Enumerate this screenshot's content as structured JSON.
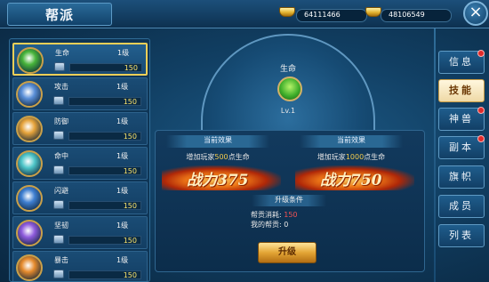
{
  "header": {
    "title": "帮派",
    "close_symbol": "×"
  },
  "currency": {
    "gold": "64111466",
    "silver": "48106549"
  },
  "skills": [
    {
      "name": "生命",
      "level": "1级",
      "cost": "150",
      "icon": "hp-potion-icon",
      "color": "#47b43a",
      "selected": true
    },
    {
      "name": "攻击",
      "level": "1级",
      "cost": "150",
      "icon": "sword-slash-icon",
      "color": "#5a8fd8"
    },
    {
      "name": "防御",
      "level": "1级",
      "cost": "150",
      "icon": "shield-icon",
      "color": "#e6a33a"
    },
    {
      "name": "命中",
      "level": "1级",
      "cost": "150",
      "icon": "eye-icon",
      "color": "#4fc6c9"
    },
    {
      "name": "闪避",
      "level": "1级",
      "cost": "150",
      "icon": "dodge-figure-icon",
      "color": "#3f7fd1"
    },
    {
      "name": "坚韧",
      "level": "1级",
      "cost": "150",
      "icon": "tough-body-icon",
      "color": "#8e5bdc"
    },
    {
      "name": "暴击",
      "level": "1级",
      "cost": "150",
      "icon": "crit-burst-icon",
      "color": "#e58a2c"
    }
  ],
  "detail": {
    "title": "生命",
    "level": "Lv.1",
    "current": {
      "header": "当前效果",
      "prefix": "增加玩家",
      "amount": "500",
      "suffix": "点生命",
      "power_label": "战力",
      "power": "375"
    },
    "next": {
      "header": "当前效果",
      "prefix": "增加玩家",
      "amount": "1000",
      "suffix": "点生命",
      "power_label": "战力",
      "power": "750"
    },
    "upgrade": {
      "header": "升级条件",
      "cost_label": "帮贡消耗:",
      "cost_value": "150",
      "have_label": "我的帮贡:",
      "have_value": "0",
      "button": "升级"
    }
  },
  "tabs": [
    {
      "label": "信息",
      "badge": true
    },
    {
      "label": "技能",
      "active": true
    },
    {
      "label": "神兽",
      "badge": true
    },
    {
      "label": "副本",
      "badge": true
    },
    {
      "label": "旗帜"
    },
    {
      "label": "成员"
    },
    {
      "label": "列表"
    }
  ],
  "colors": {
    "accent_gold": "#f4cc4c",
    "cost_yellow": "#fbe46d",
    "warn_red": "#f45252"
  }
}
